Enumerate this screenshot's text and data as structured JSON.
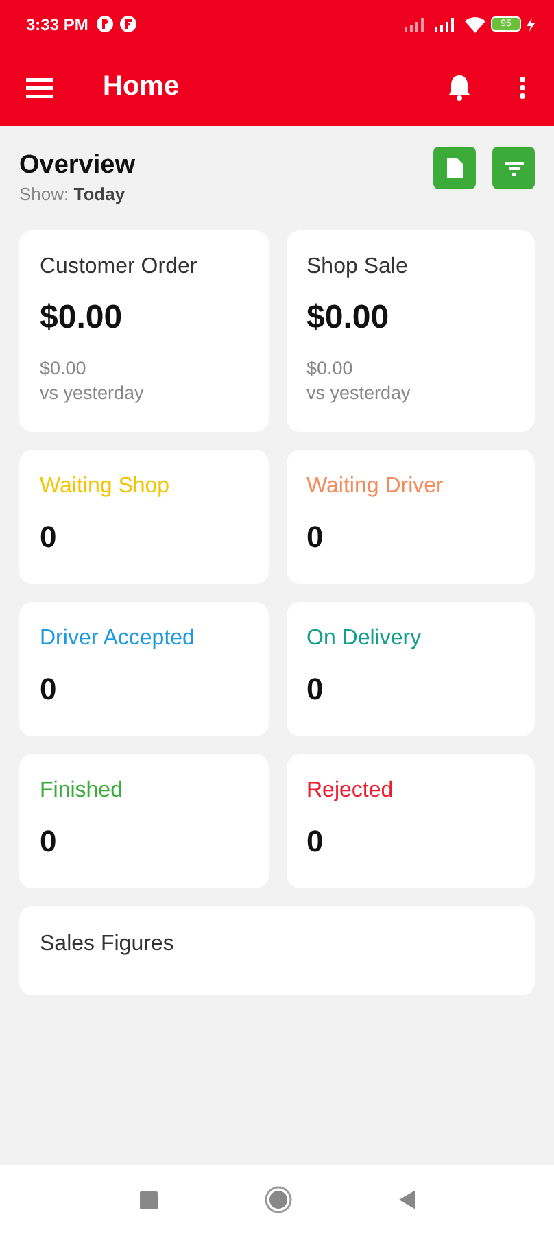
{
  "status_bar": {
    "time": "3:33 PM",
    "battery": "95"
  },
  "app_bar": {
    "title": "Home"
  },
  "overview": {
    "title": "Overview",
    "show_label": "Show:",
    "show_value": "Today"
  },
  "sales_cards": [
    {
      "title": "Customer Order",
      "amount": "$0.00",
      "compare_amount": "$0.00",
      "compare_label": "vs yesterday"
    },
    {
      "title": "Shop Sale",
      "amount": "$0.00",
      "compare_amount": "$0.00",
      "compare_label": "vs yesterday"
    }
  ],
  "status_cards": [
    {
      "label": "Waiting Shop",
      "count": "0",
      "color": "#f5c400"
    },
    {
      "label": "Waiting Driver",
      "count": "0",
      "color": "#f58a5b"
    },
    {
      "label": "Driver Accepted",
      "count": "0",
      "color": "#1e9be0"
    },
    {
      "label": "On Delivery",
      "count": "0",
      "color": "#139f8c"
    },
    {
      "label": "Finished",
      "count": "0",
      "color": "#3bab3a"
    },
    {
      "label": "Rejected",
      "count": "0",
      "color": "#ee1c2e"
    }
  ],
  "sales_figures": {
    "title": "Sales Figures"
  }
}
